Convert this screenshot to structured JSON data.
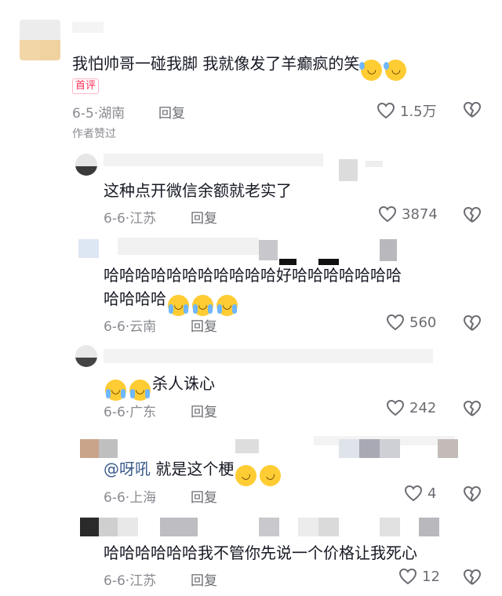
{
  "comments": [
    {
      "text": "我怕帅哥一碰我脚  我就像发了羊癫疯的笑",
      "emoji_name": "sweat-smile-emoji",
      "emoji_count": 2,
      "badge": "首评",
      "date": "6-5",
      "location": "湖南",
      "reply_label": "回复",
      "likes": "1.5万",
      "author_liked": "作者赞过"
    },
    {
      "text": "这种点开微信余额就老实了",
      "date": "6-6",
      "location": "江苏",
      "reply_label": "回复",
      "likes": "3874"
    },
    {
      "text_line1": "哈哈哈哈哈哈哈哈哈哈哈好哈哈哈哈哈哈哈",
      "text_line2": "哈哈哈哈",
      "emoji_name": "tears-of-joy-emoji",
      "emoji_count": 3,
      "date": "6-6",
      "location": "云南",
      "reply_label": "回复",
      "likes": "560"
    },
    {
      "text": "杀人诛心",
      "emoji_name": "tears-of-joy-emoji",
      "emoji_count": 2,
      "date": "6-6",
      "location": "广东",
      "reply_label": "回复",
      "likes": "242"
    },
    {
      "mention": "@呀吼",
      "text": "就是这个梗",
      "emoji_name": "rolling-laugh-emoji",
      "emoji_count": 2,
      "date": "6-6",
      "location": "上海",
      "reply_label": "回复",
      "likes": "4"
    },
    {
      "text": "哈哈哈哈哈哈我不管你先说一个价格让我死心",
      "date": "6-6",
      "location": "江苏",
      "reply_label": "回复",
      "likes": "12"
    }
  ],
  "meta_separator": "·",
  "icons": {
    "like": "heart-outline-icon",
    "dislike": "broken-heart-icon"
  },
  "colors": {
    "text": "#161823",
    "meta": "#8a8b91",
    "badge": "#fe2c55"
  }
}
